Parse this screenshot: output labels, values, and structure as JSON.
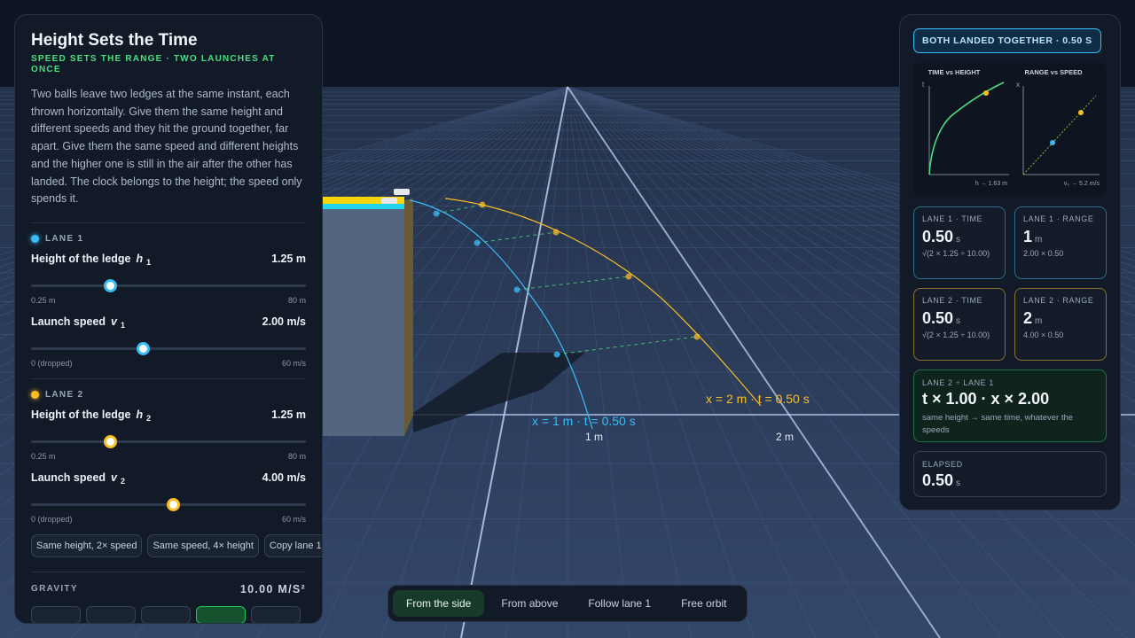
{
  "panel": {
    "title": "Height Sets the Time",
    "subtitle": "SPEED SETS THE RANGE · TWO LAUNCHES AT ONCE",
    "description": "Two balls leave two ledges at the same instant, each thrown horizontally. Give them the same height and different speeds and they hit the ground together, far apart. Give them the same speed and different heights and the higher one is still in the air after the other has landed. The clock belongs to the height; the speed only spends it."
  },
  "lane1": {
    "heading": "LANE 1",
    "height_label": "Height of the ledge",
    "height_symbol": "h",
    "height_sub": "1",
    "height_value": "1.25 m",
    "height_min": "0.25 m",
    "height_max": "80 m",
    "height_fraction": 0.29,
    "speed_label": "Launch speed",
    "speed_symbol": "v",
    "speed_sub": "1",
    "speed_value": "2.00 m/s",
    "speed_min": "0 (dropped)",
    "speed_max": "60 m/s",
    "speed_fraction": 0.41
  },
  "lane2": {
    "heading": "LANE 2",
    "height_label": "Height of the ledge",
    "height_symbol": "h",
    "height_sub": "2",
    "height_value": "1.25 m",
    "height_min": "0.25 m",
    "height_max": "80 m",
    "height_fraction": 0.29,
    "speed_label": "Launch speed",
    "speed_symbol": "v",
    "speed_sub": "2",
    "speed_value": "4.00 m/s",
    "speed_min": "0 (dropped)",
    "speed_max": "60 m/s",
    "speed_fraction": 0.52
  },
  "presets": [
    "Same height, 2× speed",
    "Same speed, 4× height",
    "Copy lane 1"
  ],
  "gravity": {
    "label": "GRAVITY",
    "value": "10.00 M/S²"
  },
  "status_badge": "BOTH LANDED TOGETHER · 0.50 S",
  "mini_charts": {
    "left_title": "TIME vs HEIGHT",
    "left_ylabel": "t",
    "left_xnote": "h → 1.63 m",
    "right_title": "RANGE vs SPEED",
    "right_ylabel": "x",
    "right_xnote": "v₀ → 5.2 m/s"
  },
  "cards": {
    "l1_time": {
      "label": "LANE 1 · TIME",
      "value": "0.50",
      "unit": "s",
      "formula": "√(2 × 1.25 ÷ 10.00)"
    },
    "l1_range": {
      "label": "LANE 1 · RANGE",
      "value": "1",
      "unit": "m",
      "formula": "2.00 × 0.50"
    },
    "l2_time": {
      "label": "LANE 2 · TIME",
      "value": "0.50",
      "unit": "s",
      "formula": "√(2 × 1.25 ÷ 10.00)"
    },
    "l2_range": {
      "label": "LANE 2 · RANGE",
      "value": "2",
      "unit": "m",
      "formula": "4.00 × 0.50"
    }
  },
  "ratio": {
    "label": "LANE 2 ÷ LANE 1",
    "value": "t × 1.00 · x × 2.00",
    "note": "same height → same time, whatever the speeds"
  },
  "elapsed": {
    "label": "ELAPSED",
    "value": "0.50",
    "unit": "s"
  },
  "scene": {
    "lane1_landing_label": "x = 1 m  · t = 0.50 s",
    "lane2_landing_label": "x = 2 m  · t = 0.50 s",
    "tick_1m": "1 m",
    "tick_2m": "2 m"
  },
  "views": [
    "From the side",
    "From above",
    "Follow lane 1",
    "Free orbit"
  ],
  "colors": {
    "lane1": "#38bdf8",
    "lane2": "#fbbf24",
    "accent": "#4ade80"
  }
}
